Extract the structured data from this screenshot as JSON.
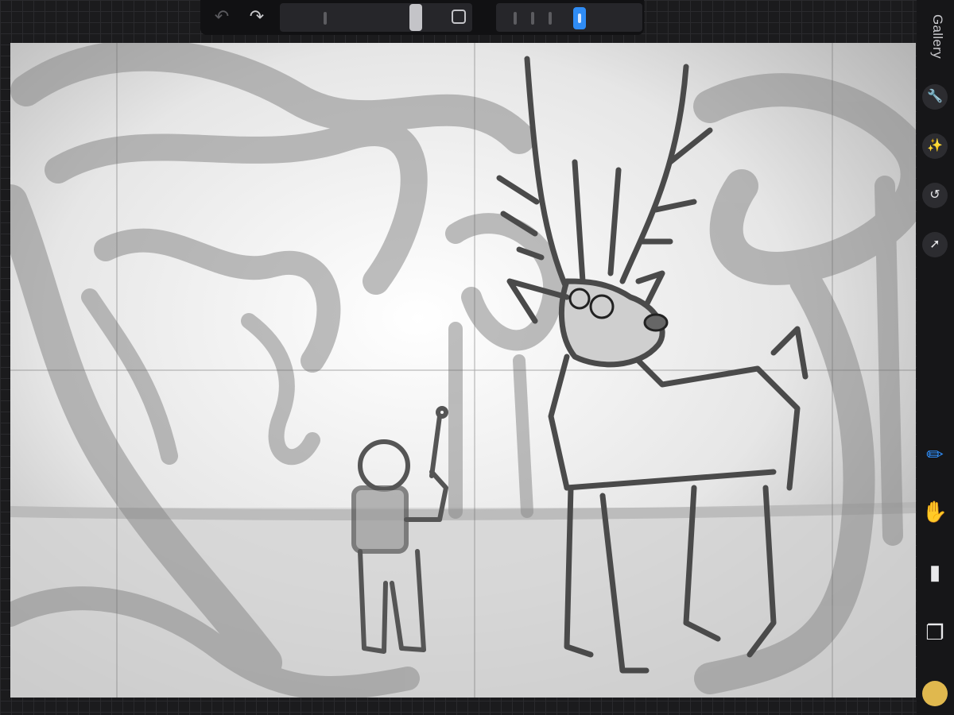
{
  "app": {
    "sidebar_title": "Gallery"
  },
  "toolbar": {
    "undo_icon": "undo-icon",
    "redo_icon": "redo-icon",
    "brush_size_percent": 72,
    "opacity_percent": 58
  },
  "colors": {
    "canvas_bg": "#f2f2f2",
    "accent_blue": "#2f8cf5",
    "current_color": "#e0b84e"
  },
  "rail_actions": [
    "wrench-icon",
    "magic-wand-icon",
    "selection-icon",
    "transform-arrow-icon"
  ],
  "tools": [
    "brush-icon",
    "smudge-icon",
    "eraser-icon",
    "layers-icon"
  ]
}
